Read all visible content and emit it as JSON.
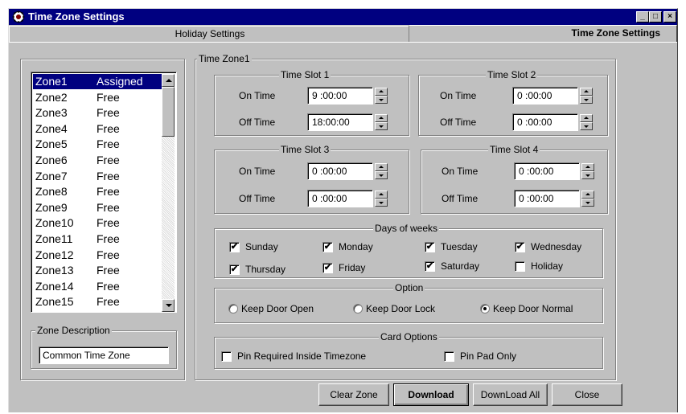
{
  "window": {
    "title": "Time Zone Settings"
  },
  "tabs": [
    {
      "label": "Holiday Settings"
    },
    {
      "label": "Time Zone Settings"
    }
  ],
  "zone_list": {
    "rows": [
      {
        "name": "Zone1",
        "status": "Assigned"
      },
      {
        "name": "Zone2",
        "status": "Free"
      },
      {
        "name": "Zone3",
        "status": "Free"
      },
      {
        "name": "Zone4",
        "status": "Free"
      },
      {
        "name": "Zone5",
        "status": "Free"
      },
      {
        "name": "Zone6",
        "status": "Free"
      },
      {
        "name": "Zone7",
        "status": "Free"
      },
      {
        "name": "Zone8",
        "status": "Free"
      },
      {
        "name": "Zone9",
        "status": "Free"
      },
      {
        "name": "Zone10",
        "status": "Free"
      },
      {
        "name": "Zone11",
        "status": "Free"
      },
      {
        "name": "Zone12",
        "status": "Free"
      },
      {
        "name": "Zone13",
        "status": "Free"
      },
      {
        "name": "Zone14",
        "status": "Free"
      },
      {
        "name": "Zone15",
        "status": "Free"
      }
    ],
    "selected": "Zone1"
  },
  "zone_description": {
    "label": "Zone Description",
    "value": "Common Time Zone"
  },
  "time_zone": {
    "title": "Time Zone1",
    "on_label": "On Time",
    "off_label": "Off Time",
    "slots": [
      {
        "title": "Time Slot 1",
        "on": "9 :00:00",
        "off": "18:00:00"
      },
      {
        "title": "Time Slot 2",
        "on": "0 :00:00",
        "off": "0 :00:00"
      },
      {
        "title": "Time Slot 3",
        "on": "0 :00:00",
        "off": "0 :00:00"
      },
      {
        "title": "Time Slot 4",
        "on": "0 :00:00",
        "off": "0 :00:00"
      }
    ]
  },
  "days": {
    "title": "Days of weeks",
    "items": [
      {
        "label": "Sunday",
        "checked": true
      },
      {
        "label": "Monday",
        "checked": true
      },
      {
        "label": "Tuesday",
        "checked": true
      },
      {
        "label": "Wednesday",
        "checked": true
      },
      {
        "label": "Thursday",
        "checked": true
      },
      {
        "label": "Friday",
        "checked": true
      },
      {
        "label": "Saturday",
        "checked": true
      },
      {
        "label": "Holiday",
        "checked": false
      }
    ]
  },
  "option": {
    "title": "Option",
    "items": [
      {
        "label": "Keep Door Open",
        "selected": false
      },
      {
        "label": "Keep Door Lock",
        "selected": false
      },
      {
        "label": "Keep Door Normal",
        "selected": true
      }
    ]
  },
  "card_options": {
    "title": "Card Options",
    "items": [
      {
        "label": "Pin Required Inside Timezone",
        "checked": false
      },
      {
        "label": "Pin Pad Only",
        "checked": false
      }
    ]
  },
  "buttons": {
    "clear_zone": "Clear Zone",
    "download": "Download",
    "download_all": "DownLoad All",
    "close": "Close"
  },
  "window_controls": {
    "minimize": "_",
    "maximize": "□",
    "close": "×"
  },
  "colors": {
    "title_bar": "#000080",
    "face": "#c0c0c0",
    "selection": "#000080"
  }
}
